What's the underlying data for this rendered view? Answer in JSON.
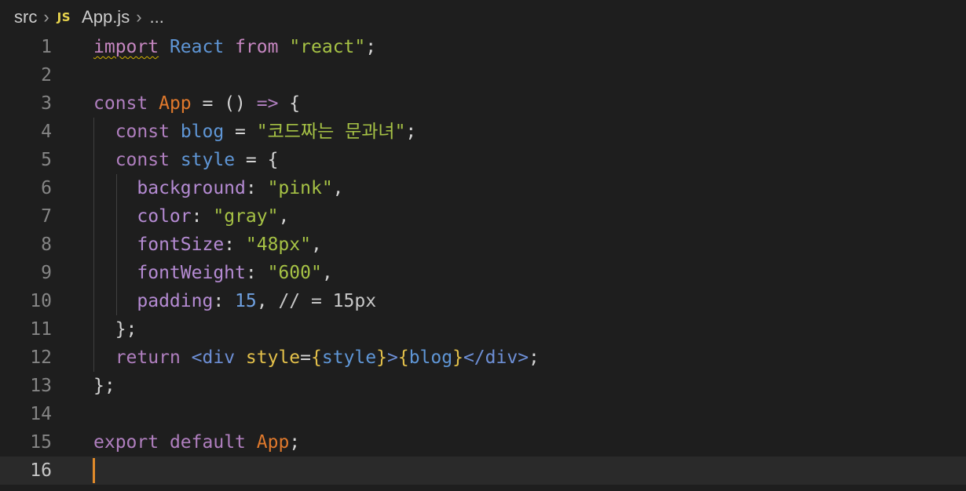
{
  "breadcrumb": {
    "folder": "src",
    "file_badge": "JS",
    "file": "App.js",
    "more": "..."
  },
  "editor": {
    "current_line": 16,
    "lines": [
      {
        "n": "1",
        "tokens": [
          [
            "kw squiggle",
            "import"
          ],
          [
            "punc",
            " "
          ],
          [
            "ident",
            "React"
          ],
          [
            "punc",
            " "
          ],
          [
            "kw",
            "from"
          ],
          [
            "punc",
            " "
          ],
          [
            "str",
            "\"react\""
          ],
          [
            "punc",
            ";"
          ]
        ]
      },
      {
        "n": "2",
        "tokens": []
      },
      {
        "n": "3",
        "tokens": [
          [
            "kwc",
            "const"
          ],
          [
            "punc",
            " "
          ],
          [
            "fn",
            "App"
          ],
          [
            "punc",
            " = () "
          ],
          [
            "kwc",
            "=>"
          ],
          [
            "punc",
            " {"
          ]
        ]
      },
      {
        "n": "4",
        "tokens": [
          [
            "punc",
            "  "
          ],
          [
            "kwc",
            "const"
          ],
          [
            "punc",
            " "
          ],
          [
            "ident",
            "blog"
          ],
          [
            "punc",
            " = "
          ],
          [
            "str",
            "\"코드짜는 문과녀\""
          ],
          [
            "punc",
            ";"
          ]
        ]
      },
      {
        "n": "5",
        "tokens": [
          [
            "punc",
            "  "
          ],
          [
            "kwc",
            "const"
          ],
          [
            "punc",
            " "
          ],
          [
            "ident",
            "style"
          ],
          [
            "punc",
            " = {"
          ]
        ]
      },
      {
        "n": "6",
        "tokens": [
          [
            "punc",
            "    "
          ],
          [
            "prop",
            "background"
          ],
          [
            "punc",
            ": "
          ],
          [
            "str",
            "\"pink\""
          ],
          [
            "punc",
            ","
          ]
        ]
      },
      {
        "n": "7",
        "tokens": [
          [
            "punc",
            "    "
          ],
          [
            "prop",
            "color"
          ],
          [
            "punc",
            ": "
          ],
          [
            "str",
            "\"gray\""
          ],
          [
            "punc",
            ","
          ]
        ]
      },
      {
        "n": "8",
        "tokens": [
          [
            "punc",
            "    "
          ],
          [
            "prop",
            "fontSize"
          ],
          [
            "punc",
            ": "
          ],
          [
            "str",
            "\"48px\""
          ],
          [
            "punc",
            ","
          ]
        ]
      },
      {
        "n": "9",
        "tokens": [
          [
            "punc",
            "    "
          ],
          [
            "prop",
            "fontWeight"
          ],
          [
            "punc",
            ": "
          ],
          [
            "str",
            "\"600\""
          ],
          [
            "punc",
            ","
          ]
        ]
      },
      {
        "n": "10",
        "tokens": [
          [
            "punc",
            "    "
          ],
          [
            "prop",
            "padding"
          ],
          [
            "punc",
            ": "
          ],
          [
            "num",
            "15"
          ],
          [
            "punc",
            ", "
          ],
          [
            "comment",
            "// = 15px"
          ]
        ]
      },
      {
        "n": "11",
        "tokens": [
          [
            "punc",
            "  };"
          ]
        ]
      },
      {
        "n": "12",
        "tokens": [
          [
            "punc",
            "  "
          ],
          [
            "kwc",
            "return"
          ],
          [
            "punc",
            " "
          ],
          [
            "tag",
            "<div"
          ],
          [
            "punc",
            " "
          ],
          [
            "attr",
            "style"
          ],
          [
            "punc",
            "="
          ],
          [
            "brace",
            "{"
          ],
          [
            "ident",
            "style"
          ],
          [
            "brace",
            "}"
          ],
          [
            "tag",
            ">"
          ],
          [
            "brace",
            "{"
          ],
          [
            "ident",
            "blog"
          ],
          [
            "brace",
            "}"
          ],
          [
            "tag",
            "</div>"
          ],
          [
            "punc",
            ";"
          ]
        ]
      },
      {
        "n": "13",
        "tokens": [
          [
            "punc",
            "};"
          ]
        ]
      },
      {
        "n": "14",
        "tokens": []
      },
      {
        "n": "15",
        "tokens": [
          [
            "kwc",
            "export"
          ],
          [
            "punc",
            " "
          ],
          [
            "kwc",
            "default"
          ],
          [
            "punc",
            " "
          ],
          [
            "fn",
            "App"
          ],
          [
            "punc",
            ";"
          ]
        ]
      },
      {
        "n": "16",
        "tokens": []
      }
    ]
  }
}
